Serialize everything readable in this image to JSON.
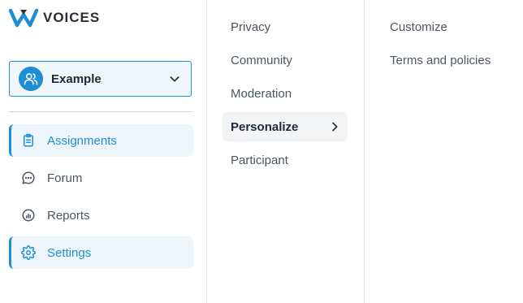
{
  "brand": {
    "name": "VOICES",
    "color": "#1e8fd5"
  },
  "workspace": {
    "name": "Example",
    "icon": "users-icon",
    "dropdown_icon": "chevron-down-icon"
  },
  "sidebar": {
    "items": [
      {
        "label": "Assignments",
        "icon": "clipboard-icon",
        "active": true
      },
      {
        "label": "Forum",
        "icon": "chat-bubble-icon",
        "active": false
      },
      {
        "label": "Reports",
        "icon": "chart-circle-icon",
        "active": false
      },
      {
        "label": "Settings",
        "icon": "gear-icon",
        "active": true
      }
    ]
  },
  "settings_menu": {
    "items": [
      {
        "label": "Privacy"
      },
      {
        "label": "Community"
      },
      {
        "label": "Moderation"
      },
      {
        "label": "Personalize",
        "selected": true,
        "icon": "chevron-right-icon"
      },
      {
        "label": "Participant"
      }
    ]
  },
  "submenu": {
    "items": [
      {
        "label": "Customize"
      },
      {
        "label": "Terms and policies"
      }
    ]
  }
}
